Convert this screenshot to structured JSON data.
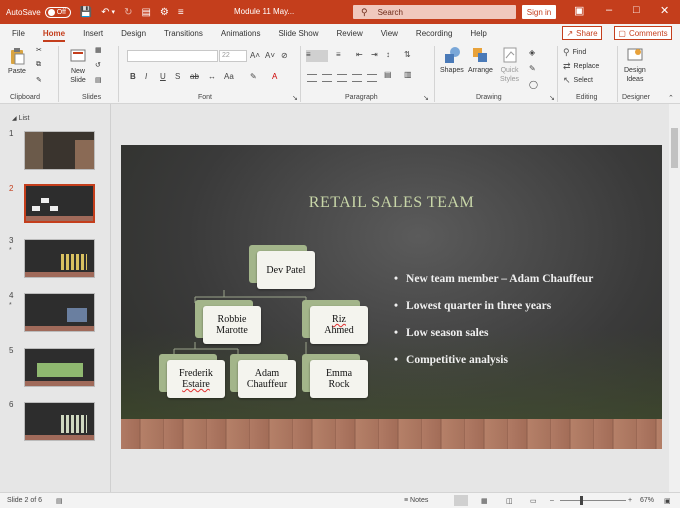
{
  "titlebar": {
    "autosave_label": "AutoSave",
    "autosave_state": "Off",
    "doc_title": "Module 11 May...",
    "search_placeholder": "Search",
    "signin_label": "Sign in",
    "accent": "#c43e1c"
  },
  "tabs": [
    "File",
    "Home",
    "Insert",
    "Design",
    "Transitions",
    "Animations",
    "Slide Show",
    "Review",
    "View",
    "Recording",
    "Help"
  ],
  "active_tab": "Home",
  "share_label": "Share",
  "comments_label": "Comments",
  "ribbon": {
    "clipboard": {
      "paste": "Paste",
      "label": "Clipboard"
    },
    "slides": {
      "new_slide_1": "New",
      "new_slide_2": "Slide",
      "label": "Slides"
    },
    "font": {
      "size": "22",
      "bold": "B",
      "italic": "I",
      "underline": "U",
      "strike": "S",
      "label": "Font"
    },
    "paragraph": {
      "label": "Paragraph"
    },
    "drawing": {
      "shapes": "Shapes",
      "arrange": "Arrange",
      "quick_styles_1": "Quick",
      "quick_styles_2": "Styles",
      "label": "Drawing"
    },
    "editing": {
      "find": "Find",
      "replace": "Replace",
      "select": "Select",
      "label": "Editing"
    },
    "designer": {
      "design_ideas_1": "Design",
      "design_ideas_2": "Ideas",
      "label": "Designer"
    }
  },
  "thumbpane": {
    "list_label": "List",
    "slides": [
      {
        "num": "1",
        "star": ""
      },
      {
        "num": "2",
        "star": ""
      },
      {
        "num": "3",
        "star": "*"
      },
      {
        "num": "4",
        "star": "*"
      },
      {
        "num": "5",
        "star": ""
      },
      {
        "num": "6",
        "star": ""
      }
    ]
  },
  "slide": {
    "title": "RETAIL SALES TEAM",
    "org": {
      "root": [
        "Dev Patel"
      ],
      "mgr1": [
        "Robbie",
        "Marotte"
      ],
      "mgr2": [
        "Riz",
        "Ahmed"
      ],
      "emp1": [
        "Frederik",
        "Estaire"
      ],
      "emp2": [
        "Adam",
        "Chauffeur"
      ],
      "emp3": [
        "Emma",
        "Rock"
      ]
    },
    "bullets": [
      "New team member – Adam Chauffeur",
      "Lowest quarter in three  years",
      "Low season sales",
      "Competitive analysis"
    ]
  },
  "statusbar": {
    "slide_info": "Slide 2 of 6",
    "notes": "Notes",
    "zoom": "67%"
  }
}
